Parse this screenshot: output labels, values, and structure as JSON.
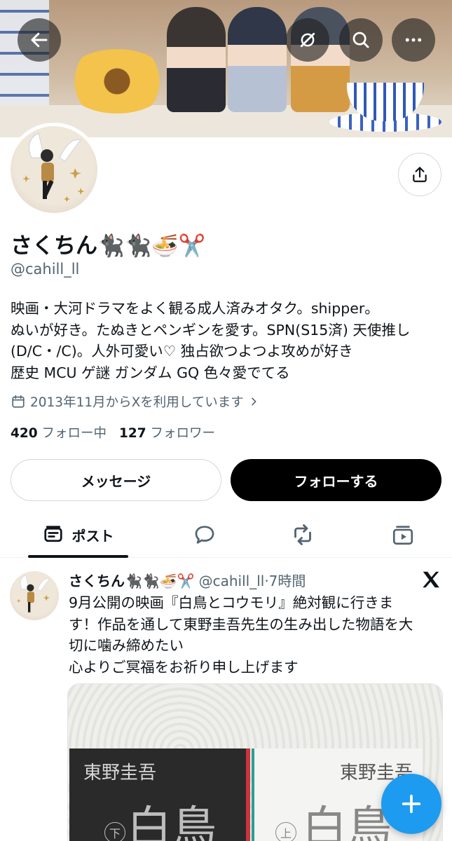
{
  "profile": {
    "name": "さくちん🐈‍⬛🐈‍⬛🍜✂️",
    "handle": "@cahill_ll",
    "bio_lines": [
      "映画・大河ドラマをよく観る成人済みオタク。shipper。",
      "ぬいが好き。たぬきとペンギンを愛す。SPN(S15済) 天使推し",
      "(D/C・/C)。人外可愛い♡ 独占欲つよつよ攻めが好き",
      "歴史 MCU ゲ謎 ガンダム GQ 色々愛でてる"
    ],
    "joined": "2013年11月からXを利用しています",
    "following_count": "420",
    "following_label": "フォロー中",
    "followers_count": "127",
    "followers_label": "フォロワー"
  },
  "actions": {
    "message_label": "メッセージ",
    "follow_label": "フォローする"
  },
  "tabs": {
    "posts_label": "ポスト"
  },
  "post": {
    "name": "さくちん🐈‍⬛🐈‍⬛🍜✂️",
    "handle_time": "@cahill_ll·7時間",
    "text_lines": [
      "9月公開の映画『白鳥とコウモリ』絶対観に行きま",
      "す！作品を通して東野圭吾先生の生み出した物語を大",
      "切に噛み締めたい",
      "心よりご冥福をお祈り申し上げます"
    ],
    "image": {
      "book_left_author": "東野圭吾",
      "book_left_title": "白鳥",
      "book_left_volume": "下",
      "book_right_author": "東野圭吾",
      "book_right_title": "白鳥",
      "book_right_volume": "上"
    }
  },
  "icons": {
    "back": "arrow-left-icon",
    "grok": "grok-icon",
    "search": "search-icon",
    "more": "more-icon",
    "share": "share-icon",
    "calendar": "calendar-icon",
    "chevron": "chevron-right-icon",
    "compose": "plus-icon",
    "x_logo": "x-logo-icon"
  },
  "colors": {
    "accent": "#1d9bf0",
    "text_primary": "#0f1419",
    "text_secondary": "#536471",
    "follow_button": "#000000"
  }
}
